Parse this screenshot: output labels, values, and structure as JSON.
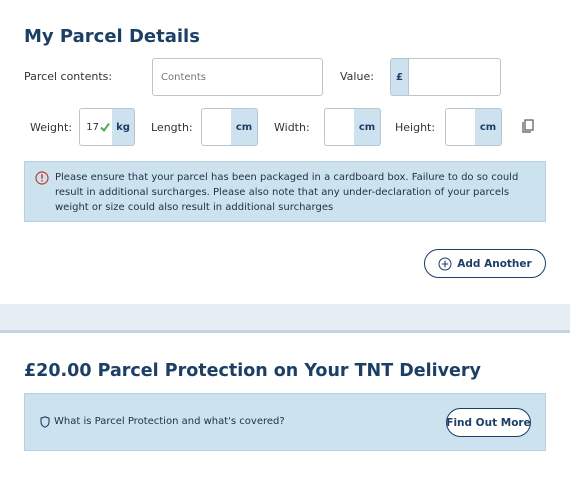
{
  "parcel_details": {
    "title": "My Parcel Details",
    "contents_label": "Parcel contents:",
    "contents_placeholder": "Contents",
    "value_label": "Value:",
    "currency_symbol": "£",
    "value": "",
    "weight_label": "Weight:",
    "weight_value": "17",
    "weight_unit": "kg",
    "length_label": "Length:",
    "length_unit": "cm",
    "width_label": "Width:",
    "width_unit": "cm",
    "height_label": "Height:",
    "height_unit": "cm",
    "copy_icon": "copy-icon",
    "valid_icon": "checkmark-icon",
    "notice_icon": "alert-circle-icon",
    "notice": "Please ensure that your parcel has been packaged in a cardboard box. Failure to do so could result in additional surcharges. Please also note that any under-declaration of your parcels weight or size could also result in additional surcharges",
    "add_another_label": "Add Another",
    "add_icon": "plus-circle-icon"
  },
  "protection": {
    "title": "£20.00 Parcel Protection on Your TNT Delivery",
    "shield_icon": "shield-icon",
    "question": "What is Parcel Protection and what's covered?",
    "find_out_label": "Find Out More"
  },
  "colors": {
    "heading": "#1c3f66",
    "info_background": "#cde2ef",
    "divider_band": "#e6edf5",
    "valid_check": "#4caf50",
    "alert_red": "#c0392b"
  }
}
